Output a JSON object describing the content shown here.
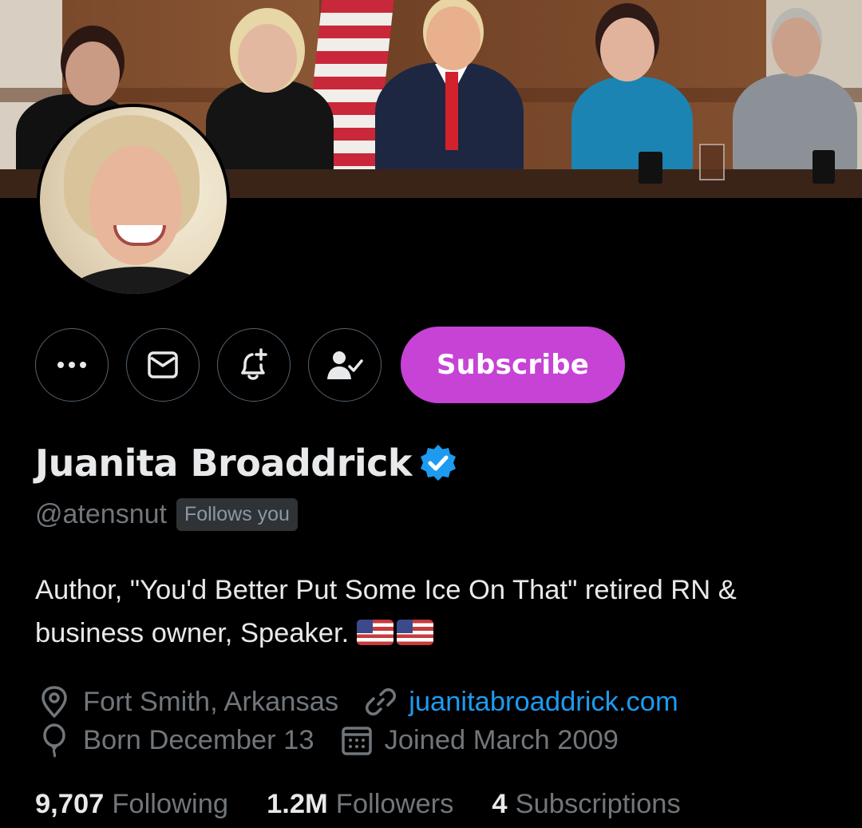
{
  "profile": {
    "display_name": "Juanita Broaddrick",
    "handle": "@atensnut",
    "follows_you_badge": "Follows you",
    "bio_text": "Author, \"You'd Better Put Some Ice On That\" retired RN & business owner, Speaker.",
    "bio_emoji": [
      "us-flag-emoji",
      "us-flag-emoji"
    ],
    "location": "Fort Smith, Arkansas",
    "website": "juanitabroaddrick.com",
    "birthday": "Born December 13",
    "joined": "Joined March 2009"
  },
  "actions": {
    "more_icon": "more-dots-icon",
    "message_icon": "envelope-icon",
    "notify_icon": "bell-plus-icon",
    "following_icon": "person-check-icon",
    "subscribe_label": "Subscribe"
  },
  "stats": {
    "following_count": "9,707",
    "following_label": "Following",
    "followers_count": "1.2M",
    "followers_label": "Followers",
    "subscriptions_count": "4",
    "subscriptions_label": "Subscriptions"
  },
  "colors": {
    "background": "#000000",
    "subscribe_button": "#c643d6",
    "verified_badge": "#1d9bf0",
    "link": "#1d9bf0",
    "secondary_text": "#71767b"
  }
}
